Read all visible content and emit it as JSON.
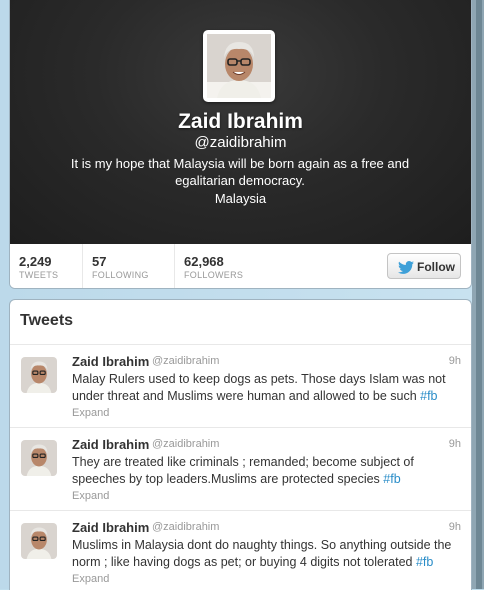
{
  "profile": {
    "display_name": "Zaid Ibrahim",
    "screen_name": "@zaidibrahim",
    "bio": "It is my hope that Malaysia will be born again as a free and egalitarian democracy.",
    "location": "Malaysia"
  },
  "stats": [
    {
      "count": "2,249",
      "label": "TWEETS"
    },
    {
      "count": "57",
      "label": "FOLLOWING"
    },
    {
      "count": "62,968",
      "label": "FOLLOWERS"
    }
  ],
  "follow_button": {
    "label": "Follow",
    "icon": "twitter-bird-icon"
  },
  "tweets_module": {
    "title": "Tweets",
    "tweets": [
      {
        "name": "Zaid Ibrahim",
        "handle": "@zaidibrahim",
        "time": "9h",
        "text": "Malay Rulers used to keep dogs as pets. Those days Islam was not under threat and Muslims were human and allowed to be such ",
        "hashtag": "#fb",
        "expand": "Expand"
      },
      {
        "name": "Zaid Ibrahim",
        "handle": "@zaidibrahim",
        "time": "9h",
        "text": "They are treated like criminals ; remanded; become subject of speeches by top leaders.Muslims are protected species ",
        "hashtag": "#fb",
        "expand": "Expand"
      },
      {
        "name": "Zaid Ibrahim",
        "handle": "@zaidibrahim",
        "time": "9h",
        "text": "Muslims in Malaysia dont do naughty things. So anything outside the norm ; like having dogs as pet; or buying 4 digits  not tolerated ",
        "hashtag": "#fb",
        "expand": "Expand"
      }
    ]
  },
  "colors": {
    "link": "#2a8dc8",
    "header_bg": "#2a2a2a",
    "page_bg": "#c0deed"
  }
}
